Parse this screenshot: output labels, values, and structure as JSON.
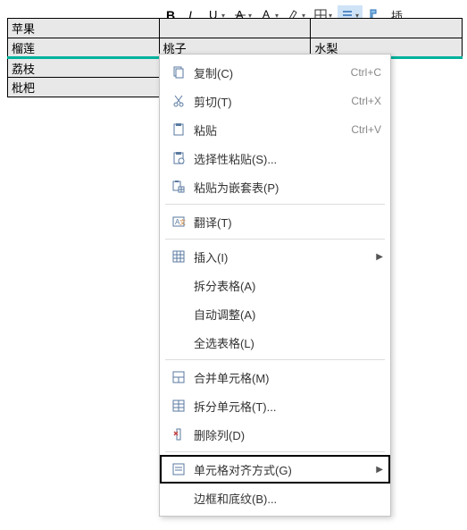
{
  "toolbar": {
    "extra_char": "插"
  },
  "table": {
    "rows": [
      [
        "苹果",
        "",
        ""
      ],
      [
        "榴莲",
        "桃子",
        "水梨"
      ],
      [
        "荔枝",
        "",
        ""
      ],
      [
        "枇杷",
        "",
        ""
      ]
    ]
  },
  "menu": {
    "items": [
      {
        "icon": "copy-icon",
        "label": "复制(C)",
        "shortcut": "Ctrl+C",
        "sub": false
      },
      {
        "icon": "cut-icon",
        "label": "剪切(T)",
        "shortcut": "Ctrl+X",
        "sub": false
      },
      {
        "icon": "paste-icon",
        "label": "粘贴",
        "shortcut": "Ctrl+V",
        "sub": false
      },
      {
        "icon": "paste-special-icon",
        "label": "选择性粘贴(S)...",
        "shortcut": "",
        "sub": false
      },
      {
        "icon": "paste-nested-icon",
        "label": "粘贴为嵌套表(P)",
        "shortcut": "",
        "sub": false
      },
      {
        "sep": true
      },
      {
        "icon": "translate-icon",
        "label": "翻译(T)",
        "shortcut": "",
        "sub": false
      },
      {
        "sep": true
      },
      {
        "icon": "insert-icon",
        "label": "插入(I)",
        "shortcut": "",
        "sub": true
      },
      {
        "icon": "",
        "label": "拆分表格(A)",
        "shortcut": "",
        "sub": false
      },
      {
        "icon": "",
        "label": "自动调整(A)",
        "shortcut": "",
        "sub": false
      },
      {
        "icon": "",
        "label": "全选表格(L)",
        "shortcut": "",
        "sub": false
      },
      {
        "sep": true
      },
      {
        "icon": "merge-icon",
        "label": "合并单元格(M)",
        "shortcut": "",
        "sub": false
      },
      {
        "icon": "split-icon",
        "label": "拆分单元格(T)...",
        "shortcut": "",
        "sub": false
      },
      {
        "icon": "delete-col-icon",
        "label": "删除列(D)",
        "shortcut": "",
        "sub": false
      },
      {
        "sep": true
      },
      {
        "icon": "align-icon",
        "label": "单元格对齐方式(G)",
        "shortcut": "",
        "sub": true,
        "boxed": true
      },
      {
        "icon": "",
        "label": "边框和底纹(B)...",
        "shortcut": "",
        "sub": false
      }
    ]
  }
}
